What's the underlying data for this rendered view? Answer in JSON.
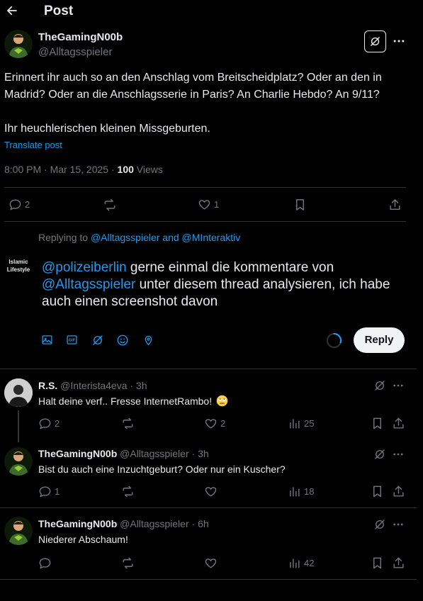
{
  "header": {
    "title": "Post"
  },
  "post": {
    "author_name": "TheGamingN00b",
    "author_handle": "@Alltagsspieler",
    "text_line1": "Erinnert ihr auch so an den Anschlag vom Breitscheidplatz? Oder an den in Madrid? Oder an die Anschlagsserie in Paris? An Charlie Hebdo? An 9/11?",
    "text_line2": "Ihr heuchlerischen kleinen Missgeburten.",
    "translate": "Translate post",
    "time": "8:00 PM · Mar 15, 2025 · ",
    "views_count": "100",
    "views_label": " Views",
    "replies": "2",
    "likes": "1"
  },
  "composer": {
    "replying_prefix": "Replying to ",
    "replying_users": "@Alltagsspieler and @MInteraktiv",
    "avatar_text": "Islamic Lifestyle",
    "mention1": "@polizeiberlin",
    "text1": " gerne einmal die kommentare von ",
    "mention2": "@Alltagsspieler",
    "text2": " unter diesem thread analysieren, ich habe auch einen screenshot davon",
    "reply_button": "Reply"
  },
  "replies": [
    {
      "name": "R.S.",
      "handle": "@Interista4eva",
      "time": "· 3h",
      "text": "Halt deine verf.. Fresse InternetRambo!",
      "replies": "2",
      "reposts": "",
      "likes": "2",
      "views": "25"
    },
    {
      "name": "TheGamingN00b",
      "handle": "@Alltagsspieler",
      "time": "· 3h",
      "text": "Bist du auch eine Inzuchtgeburt? Oder nur ein Kuscher?",
      "replies": "1",
      "reposts": "",
      "likes": "",
      "views": "18"
    },
    {
      "name": "TheGamingN00b",
      "handle": "@Alltagsspieler",
      "time": "· 6h",
      "text": "Niederer Abschaum!",
      "replies": "",
      "reposts": "",
      "likes": "",
      "views": "42"
    }
  ],
  "colors": {
    "background": "#000000",
    "text": "#e7e9ea",
    "muted": "#71767b",
    "accent": "#1d9bf0",
    "divider": "#2f3336"
  }
}
